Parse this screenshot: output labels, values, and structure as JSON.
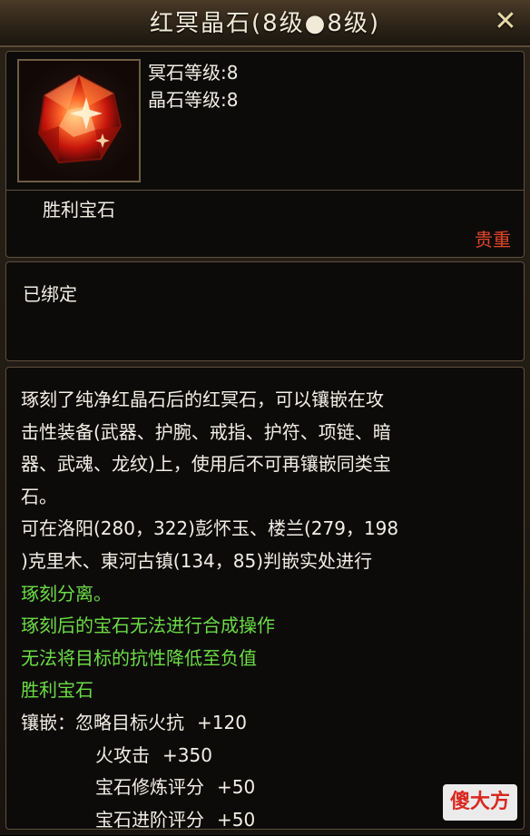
{
  "window": {
    "title": "红冥晶石(8级●8级)",
    "close_label": "✕"
  },
  "item": {
    "icon": "red-gem-icon",
    "attrs": [
      "冥石等级:8",
      "晶石等级:8"
    ],
    "name": "胜利宝石",
    "rarity": "贵重",
    "rarity_color": "#e0462b"
  },
  "bind_status": "已绑定",
  "description": {
    "lines": [
      "琢刻了纯净红晶石后的红冥石，可以镶嵌在攻",
      "击性装备(武器、护腕、戒指、护符、项链、暗",
      "器、武魂、龙纹)上，使用后不可再镶嵌同类宝",
      "石。",
      "可在洛阳(280，322)彭怀玉、楼兰(279，198",
      ")克里木、東河古镇(134，85)判嵌实处进行"
    ],
    "green_lines": [
      "琢刻分离。",
      "琢刻后的宝石无法进行合成操作",
      "无法将目标的抗性降低至负值",
      "胜利宝石"
    ],
    "green_color": "#6bdc46",
    "stats_label": "镶嵌：",
    "stats": [
      {
        "name": "忽略目标火抗",
        "value": "+120"
      },
      {
        "name": "火攻击",
        "value": "+350"
      },
      {
        "name": "宝石修炼评分",
        "value": "+50"
      },
      {
        "name": "宝石进阶评分",
        "value": "+50"
      }
    ]
  },
  "watermark": "傻大方"
}
